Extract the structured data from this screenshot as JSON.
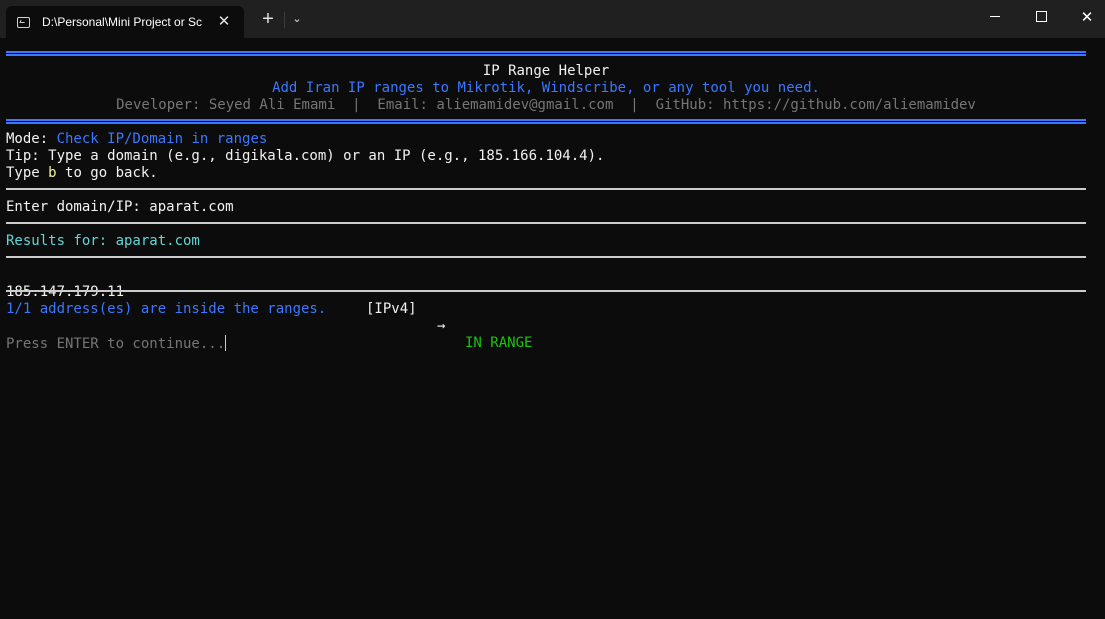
{
  "window": {
    "tab_title": "D:\\Personal\\Mini Project or Sc",
    "tab_close": "✕",
    "new_tab": "+",
    "dropdown": "⌄",
    "close": "✕"
  },
  "header": {
    "title": "IP Range Helper",
    "subtitle": "Add Iran IP ranges to Mikrotik, Windscribe, or any tool you need.",
    "credits": "Developer: Seyed Ali Emami  |  Email: aliemamidev@gmail.com  |  GitHub: https://github.com/aliemamidev"
  },
  "mode": {
    "label": "Mode: ",
    "value": "Check IP/Domain in ranges",
    "tip": "Tip: Type a domain (e.g., digikala.com) or an IP (e.g., 185.166.104.4).",
    "back_prefix": "Type ",
    "back_key": "b",
    "back_suffix": " to go back."
  },
  "input": {
    "prompt": "Enter domain/IP: ",
    "value": "aparat.com"
  },
  "results": {
    "heading_label": "Results for: ",
    "heading_value": "aparat.com",
    "rows": [
      {
        "ip": "185.147.179.11",
        "family": "[IPv4]",
        "arrow": "→",
        "status": "IN RANGE"
      }
    ],
    "summary": "1/1 address(es) are inside the ranges."
  },
  "footer": {
    "continue": "Press ENTER to continue..."
  },
  "colors": {
    "background": "#0c0c0c",
    "accent_blue": "#3b78ff",
    "cyan": "#61d6d6",
    "green": "#16c60c",
    "gray": "#767676"
  }
}
